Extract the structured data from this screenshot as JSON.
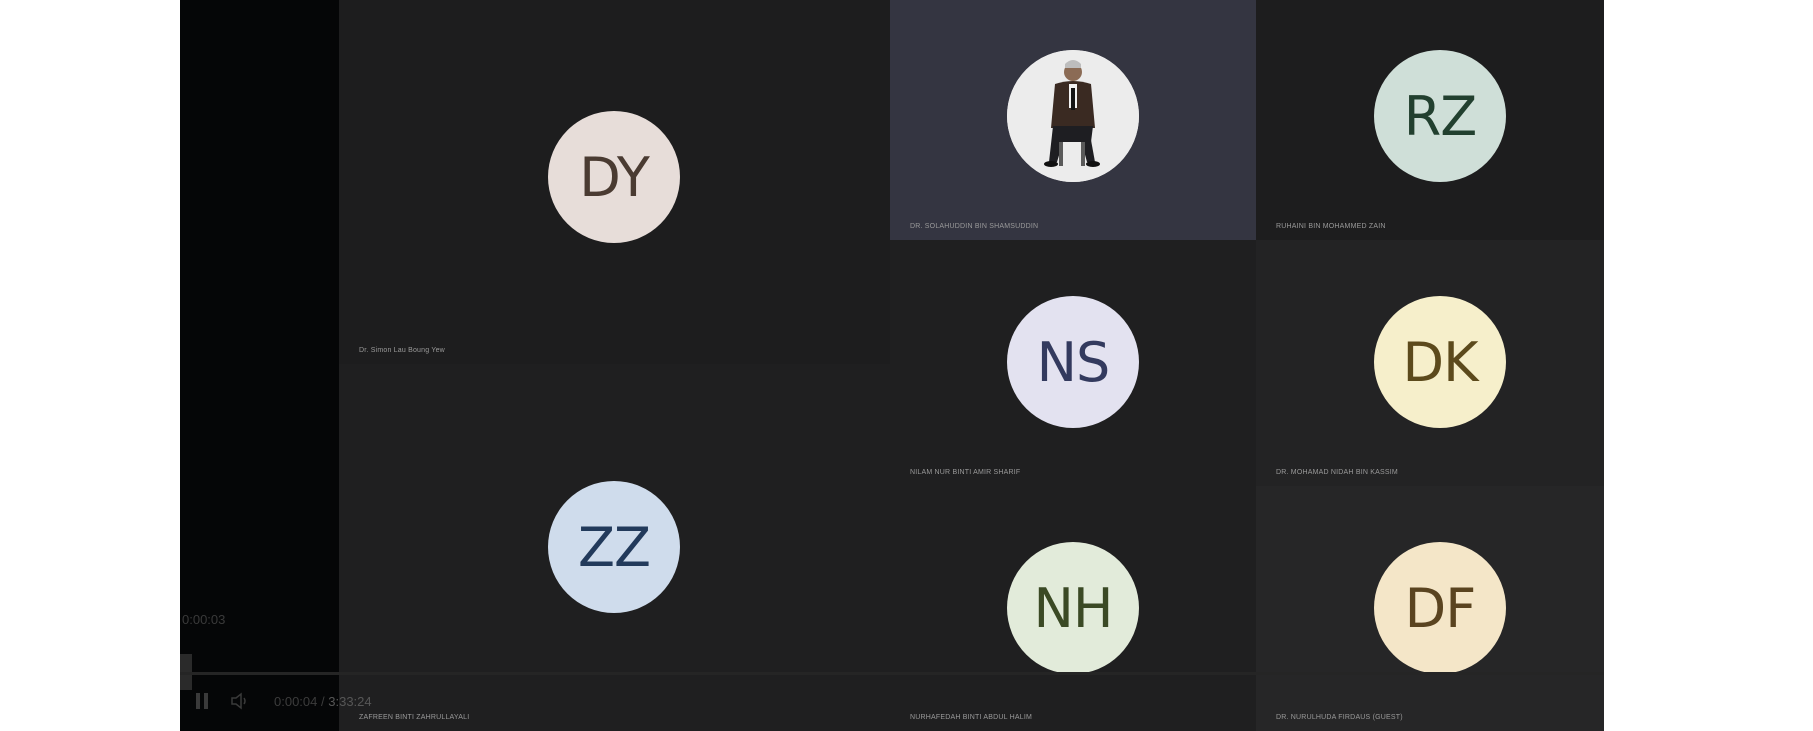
{
  "participants": [
    {
      "initials": "DY",
      "name": "Dr. Simon Lau Boung Yew",
      "avatar_bg": "#e7ddd9",
      "avatar_fg": "#4a3b32"
    },
    {
      "initials": "ZZ",
      "name": "ZAFREEN BINTI ZAHRULLAYALI",
      "avatar_bg": "#cfdcec",
      "avatar_fg": "#223a5b"
    },
    {
      "initials": "",
      "name": "DR. SOLAHUDDIN BIN SHAMSUDDIN",
      "avatar_bg": "#eeeeee",
      "avatar_fg": "#000000"
    },
    {
      "initials": "RZ",
      "name": "RUHAINI BIN MOHAMMED ZAIN",
      "avatar_bg": "#cfdfd8",
      "avatar_fg": "#22402f"
    },
    {
      "initials": "NS",
      "name": "NILAM NUR BINTI AMIR SHARIF",
      "avatar_bg": "#e3e2f0",
      "avatar_fg": "#333a5e"
    },
    {
      "initials": "DK",
      "name": "DR. MOHAMAD NIDAH BIN KASSIM",
      "avatar_bg": "#f6efcb",
      "avatar_fg": "#5c4a1c"
    },
    {
      "initials": "NH",
      "name": "NURHAFEDAH BINTI ABDUL HALIM",
      "avatar_bg": "#e2ebda",
      "avatar_fg": "#3b4a25"
    },
    {
      "initials": "DF",
      "name": "DR. NURULHUDA FIRDAUS (Guest)",
      "avatar_bg": "#f4e6c8",
      "avatar_fg": "#5a4420"
    }
  ],
  "player": {
    "elapsed_top": "0:00:03",
    "elapsed": "0:00:04",
    "separator": "/",
    "total": "3:33:24"
  },
  "icons": {
    "pause": "pause-icon",
    "volume": "volume-icon",
    "seek_handle": "seek-handle-icon"
  }
}
